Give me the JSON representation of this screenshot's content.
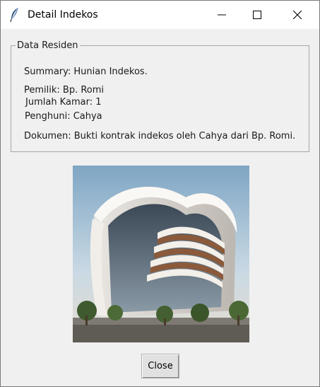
{
  "window": {
    "title": "Detail Indekos",
    "icon": "feather-icon",
    "controls": [
      "minimize-icon",
      "maximize-icon",
      "close-icon"
    ]
  },
  "group": {
    "legend": "Data Residen",
    "summary": "Summary: Hunian Indekos.",
    "owner": "Pemilik: Bp. Romi",
    "rooms": "Jumlah Kamar: 1",
    "tenant": "Penghuni: Cahya",
    "document": "Dokumen: Bukti kontrak indekos oleh Cahya dari Bp. Romi."
  },
  "image": {
    "subject": "modern-building-illustration"
  },
  "buttons": {
    "close_label": "Close"
  }
}
